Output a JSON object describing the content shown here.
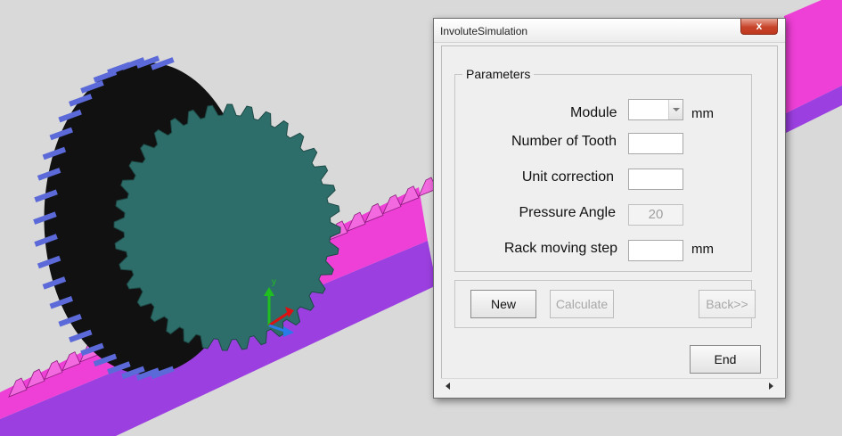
{
  "window": {
    "title": "InvoluteSimulation",
    "close_label": "x"
  },
  "parameters": {
    "group_label": "Parameters",
    "module": {
      "label": "Module",
      "value": "",
      "unit": "mm"
    },
    "teeth": {
      "label": "Number of Tooth",
      "value": ""
    },
    "correction": {
      "label": "Unit correction",
      "value": ""
    },
    "pressure_angle": {
      "label": "Pressure Angle",
      "value": "20"
    },
    "rack_step": {
      "label": "Rack moving step",
      "value": "",
      "unit": "mm"
    }
  },
  "buttons": {
    "new": "New",
    "calculate": "Calculate",
    "back": "Back>>",
    "end": "End"
  },
  "colors": {
    "background": "#d9d9d9",
    "gear_face": "#2e6e6a",
    "gear_teeth_top": "#5b6ad8",
    "rack_side": "#ee3fd6",
    "rack_base": "#9b3fe0"
  },
  "axis_label": "y"
}
